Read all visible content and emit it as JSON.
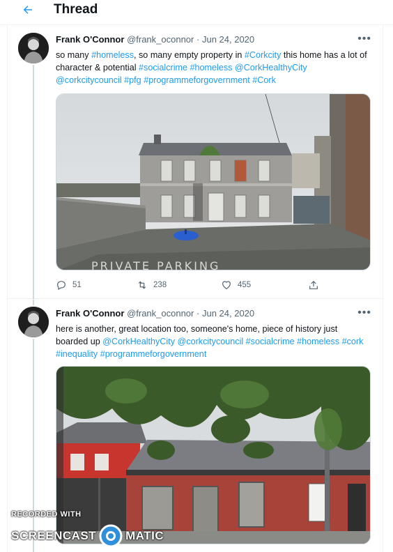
{
  "header": {
    "title": "Thread",
    "back_icon": "arrow-left-icon"
  },
  "tweets": [
    {
      "name": "Frank O'Connor",
      "handle": "@frank_oconnor",
      "separator": "·",
      "date": "Jun 24, 2020",
      "more": "•••",
      "text_segments": [
        {
          "text": "so many ",
          "link": false
        },
        {
          "text": "#homeless",
          "link": true
        },
        {
          "text": ", so many empty property in ",
          "link": false
        },
        {
          "text": "#Corkcity",
          "link": true
        },
        {
          "text": " this home has a lot of character & potential ",
          "link": false
        },
        {
          "text": "#socialcrime",
          "link": true
        },
        {
          "text": " ",
          "link": false
        },
        {
          "text": "#homeless",
          "link": true
        },
        {
          "text": " ",
          "link": false
        },
        {
          "text": "@CorkHealthyCity",
          "link": true
        },
        {
          "text": " ",
          "link": false
        },
        {
          "text": "@corkcitycouncil",
          "link": true
        },
        {
          "text": " ",
          "link": false
        },
        {
          "text": "#pfg",
          "link": true
        },
        {
          "text": " ",
          "link": false
        },
        {
          "text": "#programmeforgovernment",
          "link": true
        },
        {
          "text": " ",
          "link": false
        },
        {
          "text": "#Cork",
          "link": true
        }
      ],
      "media_alt": "Boarded-up two-storey house with private parking lot",
      "replies": "51",
      "retweets": "238",
      "likes": "455"
    },
    {
      "name": "Frank O'Connor",
      "handle": "@frank_oconnor",
      "separator": "·",
      "date": "Jun 24, 2020",
      "more": "•••",
      "text_segments": [
        {
          "text": "here is another, great location too, someone's home, piece of history just boarded up ",
          "link": false
        },
        {
          "text": "@CorkHealthyCity",
          "link": true
        },
        {
          "text": " ",
          "link": false
        },
        {
          "text": "@corkcitycouncil",
          "link": true
        },
        {
          "text": " ",
          "link": false
        },
        {
          "text": "#socialcrime",
          "link": true
        },
        {
          "text": " ",
          "link": false
        },
        {
          "text": "#homeless",
          "link": true
        },
        {
          "text": " ",
          "link": false
        },
        {
          "text": "#cork",
          "link": true
        },
        {
          "text": " ",
          "link": false
        },
        {
          "text": "#inequality",
          "link": true
        },
        {
          "text": " ",
          "link": false
        },
        {
          "text": "#programmeforgovernment",
          "link": true
        }
      ],
      "media_alt": "Boarded-up red single-storey terrace behind trees"
    }
  ],
  "photo1_ground_text": "PRIVATE PARKING",
  "watermark": {
    "top": "RECORDED WITH",
    "left": "SCREENCAST",
    "right": "MATIC"
  },
  "colors": {
    "accent": "#1d9bf0",
    "text": "#0f1419",
    "muted": "#536471",
    "border": "#eff3f4"
  }
}
